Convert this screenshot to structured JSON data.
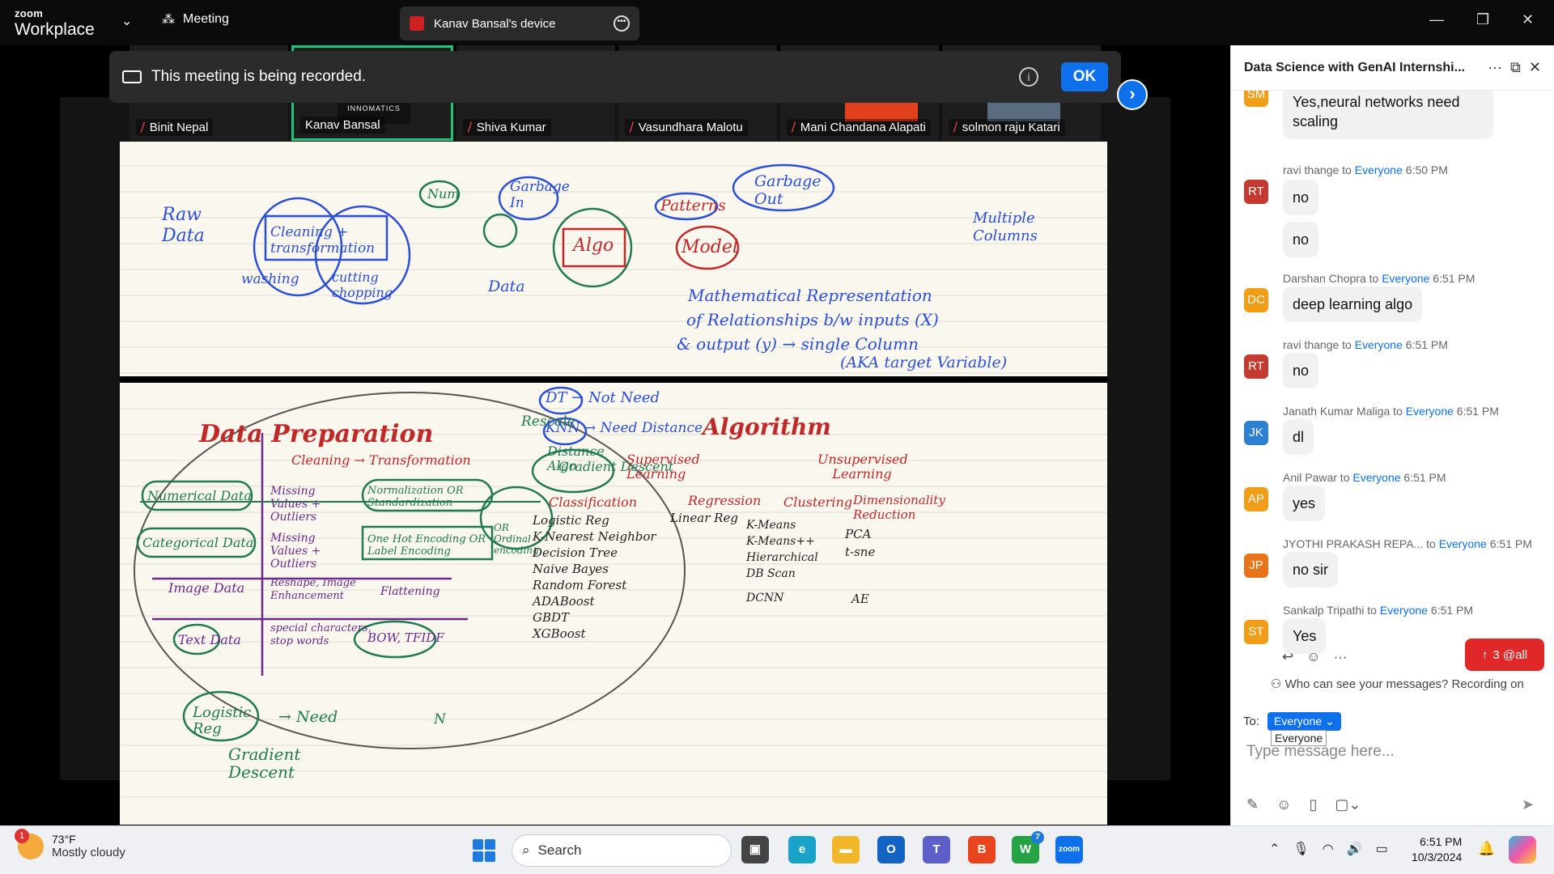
{
  "titlebar": {
    "brand_small": "zoom",
    "brand_big": "Workplace",
    "meeting_label": "Meeting",
    "device_label": "Kanav Bansal's device"
  },
  "participants": [
    {
      "name": "Binit Nepal",
      "muted": true,
      "active": false
    },
    {
      "name": "Kanav Bansal",
      "muted": false,
      "active": true
    },
    {
      "name": "Shiva Kumar",
      "muted": true,
      "active": false
    },
    {
      "name": "Vasundhara Malotu",
      "muted": true,
      "active": false
    },
    {
      "name": "Mani Chandana Alapati",
      "muted": true,
      "active": false
    },
    {
      "name": "solmon raju Katari",
      "muted": true,
      "active": false
    }
  ],
  "tile_logo": "INNOMATICS",
  "banner": {
    "text": "This meeting is being recorded.",
    "ok": "OK"
  },
  "slide": {
    "top": {
      "raw_data": "Raw Data",
      "cleaning": "Cleaning + transformation",
      "washing": "washing",
      "cutting": "cutting chopping",
      "num": "Num",
      "garbage_in": "Garbage In",
      "garbage_out": "Garbage Out",
      "patterns": "Patterns",
      "algo": "Algo",
      "model": "Model",
      "data": "Data",
      "multiple": "Multiple Columns",
      "math1": "Mathematical Representation",
      "math2": "of Relationships b/w inputs (X)",
      "math3": "& output (y) → single Column",
      "math4": "(AKA target Variable)"
    },
    "bottom": {
      "title": "Data Preparation",
      "cleaning": "Cleaning → Transformation",
      "numerical": "Numerical Data",
      "categorical": "Categorical Data",
      "image": "Image Data",
      "text": "Text Data",
      "missing1": "Missing Values + Outliers",
      "missing2": "Missing Values + Outliers",
      "reshape": "Reshape, Image Enhancement",
      "special": "special characters, stop words",
      "normalization": "Normalization OR Standardization",
      "onehot": "One Hot Encoding OR Label Encoding",
      "ordinal": "OR Ordinal encoding",
      "flattening": "Flattening",
      "bow": "BOW, TFIDF",
      "rescale": "Rescale",
      "distance": "Distance Algo",
      "gradient_descent_top": "Gradient Descent",
      "dt": "DT → Not Need",
      "knn": "KNN → Need Distance",
      "algorithm": "Algorithm",
      "supervised": "Supervised Learning",
      "unsupervised": "Unsupervised Learning",
      "classification": "Classification",
      "regression": "Regression",
      "clustering": "Clustering",
      "dimred": "Dimensionality Reduction",
      "class_items": [
        "Logistic Reg",
        "K-Nearest Neighbor",
        "Decision Tree",
        "Naive Bayes",
        "Random Forest",
        "ADABoost",
        "GBDT",
        "XGBoost"
      ],
      "reg_items": [
        "Linear Reg"
      ],
      "clust_items": [
        "K-Means",
        "K-Means++",
        "Hierarchical",
        "DB Scan",
        "DCNN"
      ],
      "dim_items": [
        "PCA",
        "t-sne",
        "AE"
      ],
      "logistic": "Logistic Reg",
      "need": "→ Need",
      "gradient": "Gradient Descent",
      "n": "N"
    }
  },
  "chat": {
    "title": "Data Science with GenAI Internshi...",
    "messages": [
      {
        "initials": "SM",
        "color": "#f29d18",
        "sender": "",
        "to": "",
        "time": "",
        "text": "Yes,neural networks need scaling"
      },
      {
        "initials": "RT",
        "color": "#c43a31",
        "sender": "ravi thange to ",
        "to": "Everyone",
        "time": " 6:50 PM",
        "text": "no"
      },
      {
        "initials": "",
        "color": "",
        "sender": "",
        "to": "",
        "time": "",
        "text": "no"
      },
      {
        "initials": "DC",
        "color": "#f29d18",
        "sender": "Darshan Chopra to ",
        "to": "Everyone",
        "time": " 6:51 PM",
        "text": "deep learning algo"
      },
      {
        "initials": "RT",
        "color": "#c43a31",
        "sender": "ravi thange to ",
        "to": "Everyone",
        "time": " 6:51 PM",
        "text": "no"
      },
      {
        "initials": "JK",
        "color": "#2d7fd1",
        "sender": "Janath Kumar Maliga to ",
        "to": "Everyone",
        "time": " 6:51 PM",
        "text": "dl"
      },
      {
        "initials": "AP",
        "color": "#f29d18",
        "sender": "Anil Pawar to ",
        "to": "Everyone",
        "time": " 6:51 PM",
        "text": "yes"
      },
      {
        "initials": "JP",
        "color": "#e8741a",
        "sender": "JYOTHI PRAKASH REPA...  to ",
        "to": "Everyone",
        "time": " 6:51 PM",
        "text": "no sir"
      },
      {
        "initials": "ST",
        "color": "#f29d18",
        "sender": "Sankalp Tripathi to ",
        "to": "Everyone",
        "time": " 6:51 PM",
        "text": "Yes"
      }
    ],
    "mention_button": "3 @all",
    "privacy": "Who can see your messages? Recording on",
    "to_label": "To:",
    "to_value": "Everyone",
    "tooltip": "Everyone",
    "placeholder": "Type message here..."
  },
  "taskbar": {
    "badge": "1",
    "temp": "73°F",
    "weather": "Mostly cloudy",
    "search": "Search",
    "whatsapp_badge": "7",
    "zoom_label": "zoom",
    "time": "6:51 PM",
    "date": "10/3/2024"
  }
}
